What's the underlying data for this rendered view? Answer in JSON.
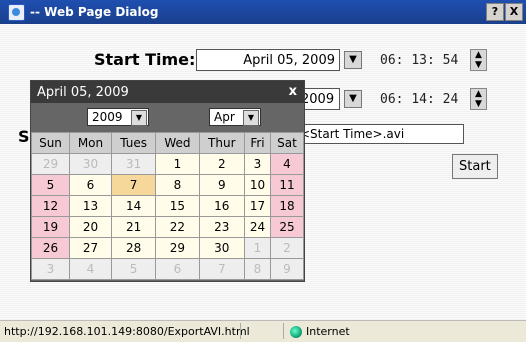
{
  "window": {
    "title": "-- Web Page Dialog",
    "help": "?",
    "close": "X"
  },
  "form": {
    "start_label": "Start Time:",
    "start_date": "April 05, 2009",
    "start_time": {
      "h": "06",
      "m": "13",
      "s": "54"
    },
    "end_year_partial": "2009",
    "end_time": {
      "h": "06",
      "m": "14",
      "s": "24"
    },
    "save_label_partial": "S",
    "filename": "<Start Time>.avi",
    "start_button": "Start"
  },
  "calendar": {
    "header": "April 05, 2009",
    "close": "x",
    "year": "2009",
    "month": "Apr",
    "days": [
      "Sun",
      "Mon",
      "Tues",
      "Wed",
      "Thur",
      "Fri",
      "Sat"
    ],
    "weeks": [
      [
        "29",
        "30",
        "31",
        "1",
        "2",
        "3",
        "4"
      ],
      [
        "5",
        "6",
        "7",
        "8",
        "9",
        "10",
        "11"
      ],
      [
        "12",
        "13",
        "14",
        "15",
        "16",
        "17",
        "18"
      ],
      [
        "19",
        "20",
        "21",
        "22",
        "23",
        "24",
        "25"
      ],
      [
        "26",
        "27",
        "28",
        "29",
        "30",
        "1",
        "2"
      ],
      [
        "3",
        "4",
        "5",
        "6",
        "7",
        "8",
        "9"
      ]
    ]
  },
  "status": {
    "url": "http://192.168.101.149:8080/ExportAVI.html",
    "zone": "Internet"
  }
}
